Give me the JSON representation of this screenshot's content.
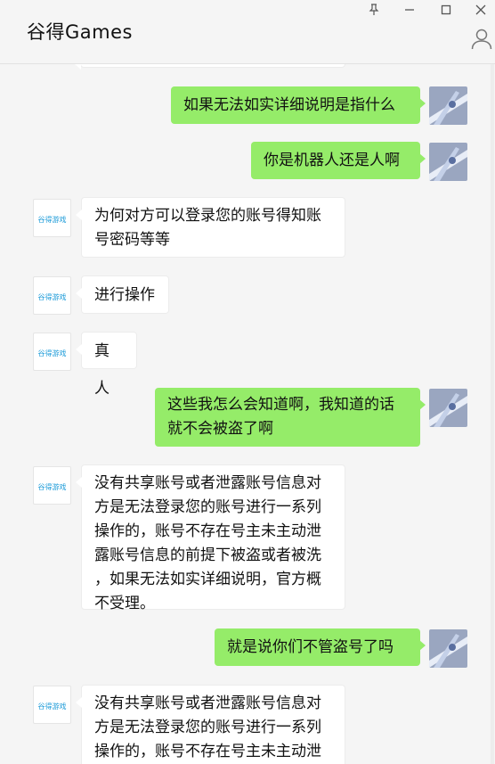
{
  "window": {
    "title": "谷得Games",
    "controls": {
      "pin": "pin-icon",
      "minimize": "minimize-icon",
      "maximize": "maximize-icon",
      "close": "close-icon"
    }
  },
  "colors": {
    "my_bubble": "#95ec69",
    "other_bubble": "#ffffff",
    "background": "#f5f5f5"
  },
  "messages": [
    {
      "from": "me",
      "text": "如果无法如实详细说明是指什么"
    },
    {
      "from": "me",
      "text": "你是机器人还是人啊"
    },
    {
      "from": "other",
      "text": "为何对方可以登录您的账号得知账\n号密码等等"
    },
    {
      "from": "other",
      "text": "进行操作"
    },
    {
      "from": "other",
      "text": "真人"
    },
    {
      "from": "me",
      "text": "这些我怎么会知道啊，我知道的话\n就不会被盗了啊"
    },
    {
      "from": "other",
      "text": "没有共享账号或者泄露账号信息对\n方是无法登录您的账号进行一系列\n操作的，账号不存在号主未主动泄\n露账号信息的前提下被盗或者被洗\n，如果无法如实详细说明，官方概\n不受理。"
    },
    {
      "from": "me",
      "text": "就是说你们不管盗号了吗"
    },
    {
      "from": "other",
      "text": "没有共享账号或者泄露账号信息对\n方是无法登录您的账号进行一系列\n操作的，账号不存在号主未主动泄\n露账号信息的前提下被盗或者被洗"
    }
  ],
  "other_avatar_logo": "谷得游戏"
}
